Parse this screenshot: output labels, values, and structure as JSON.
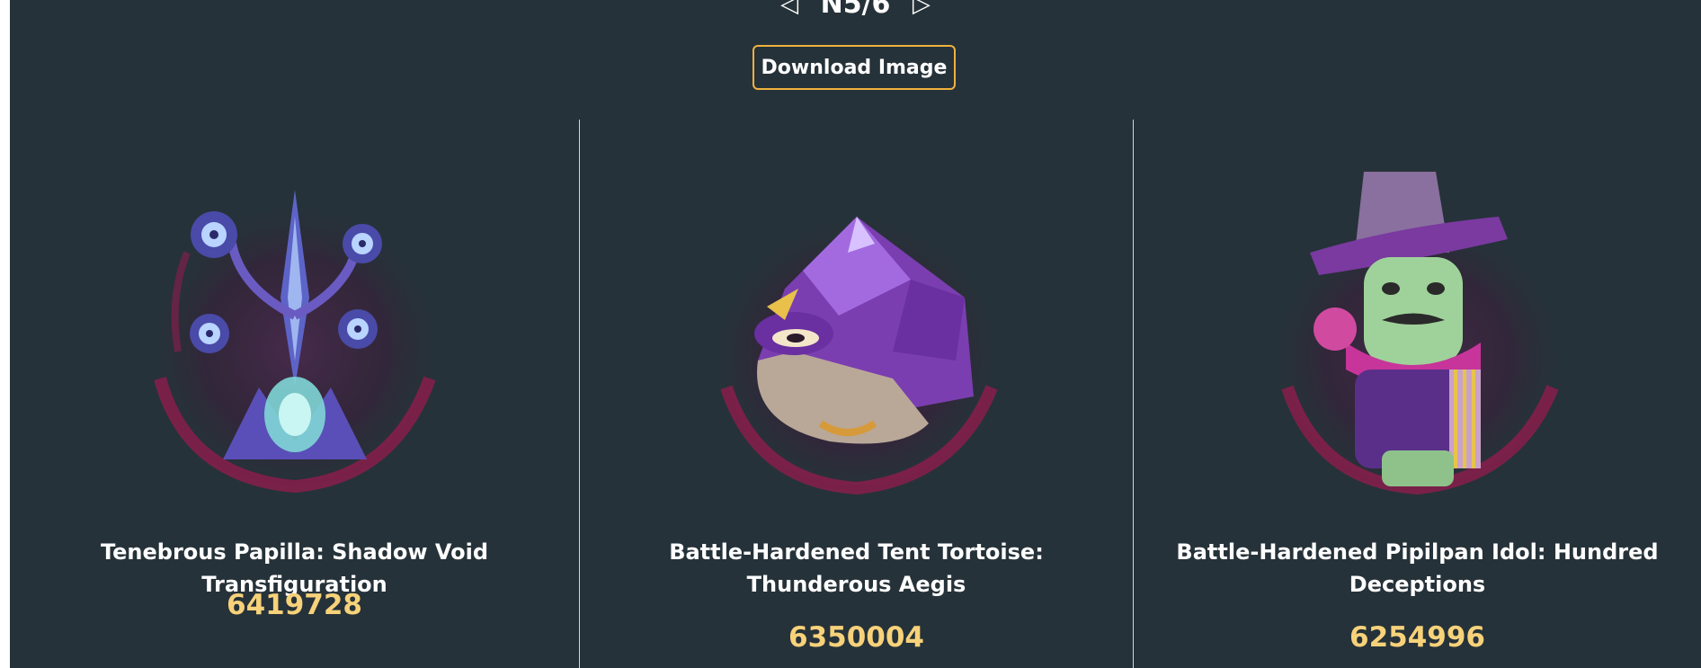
{
  "pager": {
    "text": "N5/6",
    "prev_icon": "triangle-left-icon",
    "next_icon": "triangle-right-icon"
  },
  "download_button": {
    "label": "Download Image"
  },
  "colors": {
    "background": "#263239",
    "accent": "#f0b13f",
    "score": "#f7d27a"
  },
  "cards": [
    {
      "name": "Tenebrous Papilla: Shadow Void Transfiguration",
      "score": "6419728"
    },
    {
      "name": "Battle-Hardened Tent Tortoise: Thunderous Aegis",
      "score": "6350004"
    },
    {
      "name": "Battle-Hardened Pipilpan Idol: Hundred Deceptions",
      "score": "6254996"
    }
  ]
}
